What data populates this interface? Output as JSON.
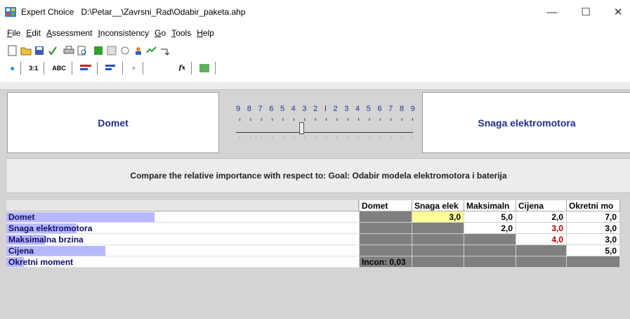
{
  "window": {
    "app_name": "Expert Choice",
    "file_path": "D:\\Petar__\\Zavrsni_Rad\\Odabir_paketa.ahp",
    "minimize": "—",
    "maximize": "☐",
    "close": "✕"
  },
  "menu": [
    {
      "accel": "F",
      "rest": "ile"
    },
    {
      "accel": "E",
      "rest": "dit"
    },
    {
      "accel": "A",
      "rest": "ssessment"
    },
    {
      "accel": "I",
      "rest": "nconsistency"
    },
    {
      "accel": "G",
      "rest": "o"
    },
    {
      "accel": "T",
      "rest": "ools"
    },
    {
      "accel": "H",
      "rest": "elp"
    }
  ],
  "toolbar_icons": [
    "new-file-icon",
    "open-folder-icon",
    "save-icon",
    "check-icon",
    "print-icon",
    "print-preview-icon",
    "green-grid-icon",
    "chart-icon",
    "model-icon",
    "people-icon",
    "sensitivity-icon",
    "arrow-icon"
  ],
  "tabs": [
    {
      "name": "tab-numerical",
      "label": "",
      "icon": "numerical-icon"
    },
    {
      "name": "tab-ratio",
      "label": "3:1",
      "icon": ""
    },
    {
      "name": "tab-verbal",
      "label": "ABC",
      "icon": ""
    },
    {
      "name": "tab-graphical",
      "label": "",
      "icon": "bars-red-blue-icon"
    },
    {
      "name": "tab-questionnaire",
      "label": "",
      "icon": "bars-blue-icon"
    },
    {
      "name": "tab-tree",
      "label": "",
      "icon": "tree-icon"
    },
    {
      "name": "tab-formula",
      "label": "fx",
      "icon": ""
    },
    {
      "name": "tab-matrix",
      "label": "",
      "icon": "grid-icon"
    }
  ],
  "comparison": {
    "left": "Domet",
    "right": "Snaga elektromotora",
    "scale": [
      "9",
      "8",
      "7",
      "6",
      "5",
      "4",
      "3",
      "2",
      "1",
      "2",
      "3",
      "4",
      "5",
      "6",
      "7",
      "8",
      "9"
    ],
    "slider_value": "3",
    "slider_side": "left"
  },
  "compare_text": "Compare the relative importance with respect to: Goal: Odabir modela elektromotora i baterija",
  "matrix": {
    "columns": [
      "Domet",
      "Snaga elek",
      "Maksimaln",
      "Cijena",
      "Okretni mo"
    ],
    "rows": [
      {
        "label": "Domet",
        "bar": 0.42,
        "cells": [
          "",
          "3,0",
          "5,0",
          "2,0",
          "7,0"
        ]
      },
      {
        "label": "Snaga elektromotora",
        "bar": 0.2,
        "cells": [
          "",
          "",
          "2,0",
          "3,0",
          "3,0"
        ]
      },
      {
        "label": "Maksimalna brzina",
        "bar": 0.11,
        "cells": [
          "",
          "",
          "",
          "4,0",
          "3,0"
        ]
      },
      {
        "label": "Cijena",
        "bar": 0.28,
        "cells": [
          "",
          "",
          "",
          "",
          "5,0"
        ]
      },
      {
        "label": "Okretni moment",
        "bar": 0.05,
        "cells": [
          "Incon: 0,03",
          "",
          "",
          "",
          ""
        ]
      }
    ]
  },
  "colors": {
    "accent_text": "#1f2f8c",
    "inverse_red": "#b40000",
    "row_bar": "#b8b8ff",
    "selected_cell": "#ffff99"
  }
}
